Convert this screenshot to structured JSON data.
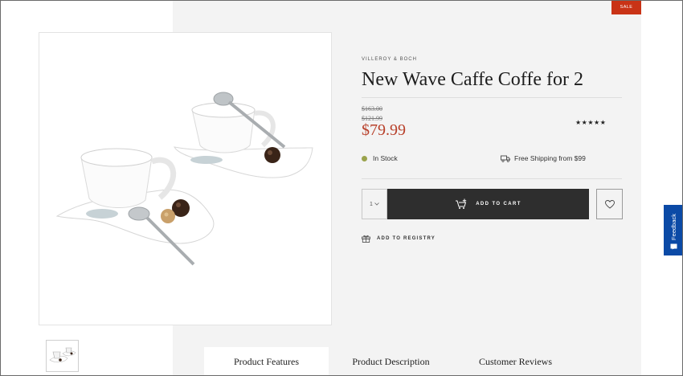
{
  "badge": {
    "sale": "SALE"
  },
  "product": {
    "brand": "VILLEROY & BOCH",
    "title": "New Wave Caffe Coffe for 2",
    "price_original": "$163.00",
    "price_previous": "$121.99",
    "price_current": "$79.99",
    "rating_stars": "★★★★★"
  },
  "availability": {
    "stock": "In Stock",
    "shipping": "Free Shipping from $99"
  },
  "purchase": {
    "quantity": "1",
    "add_to_cart": "ADD TO CART",
    "registry": "ADD TO REGISTRY"
  },
  "tabs": [
    {
      "label": "Product Features"
    },
    {
      "label": "Product Description"
    },
    {
      "label": "Customer Reviews"
    }
  ],
  "feedback": {
    "label": "Feedback"
  },
  "colors": {
    "sale": "#c93316",
    "price": "#b8402a",
    "cart_button": "#2e2e2e",
    "feedback": "#0b4aa6",
    "stock_dot": "#9aa34c"
  }
}
